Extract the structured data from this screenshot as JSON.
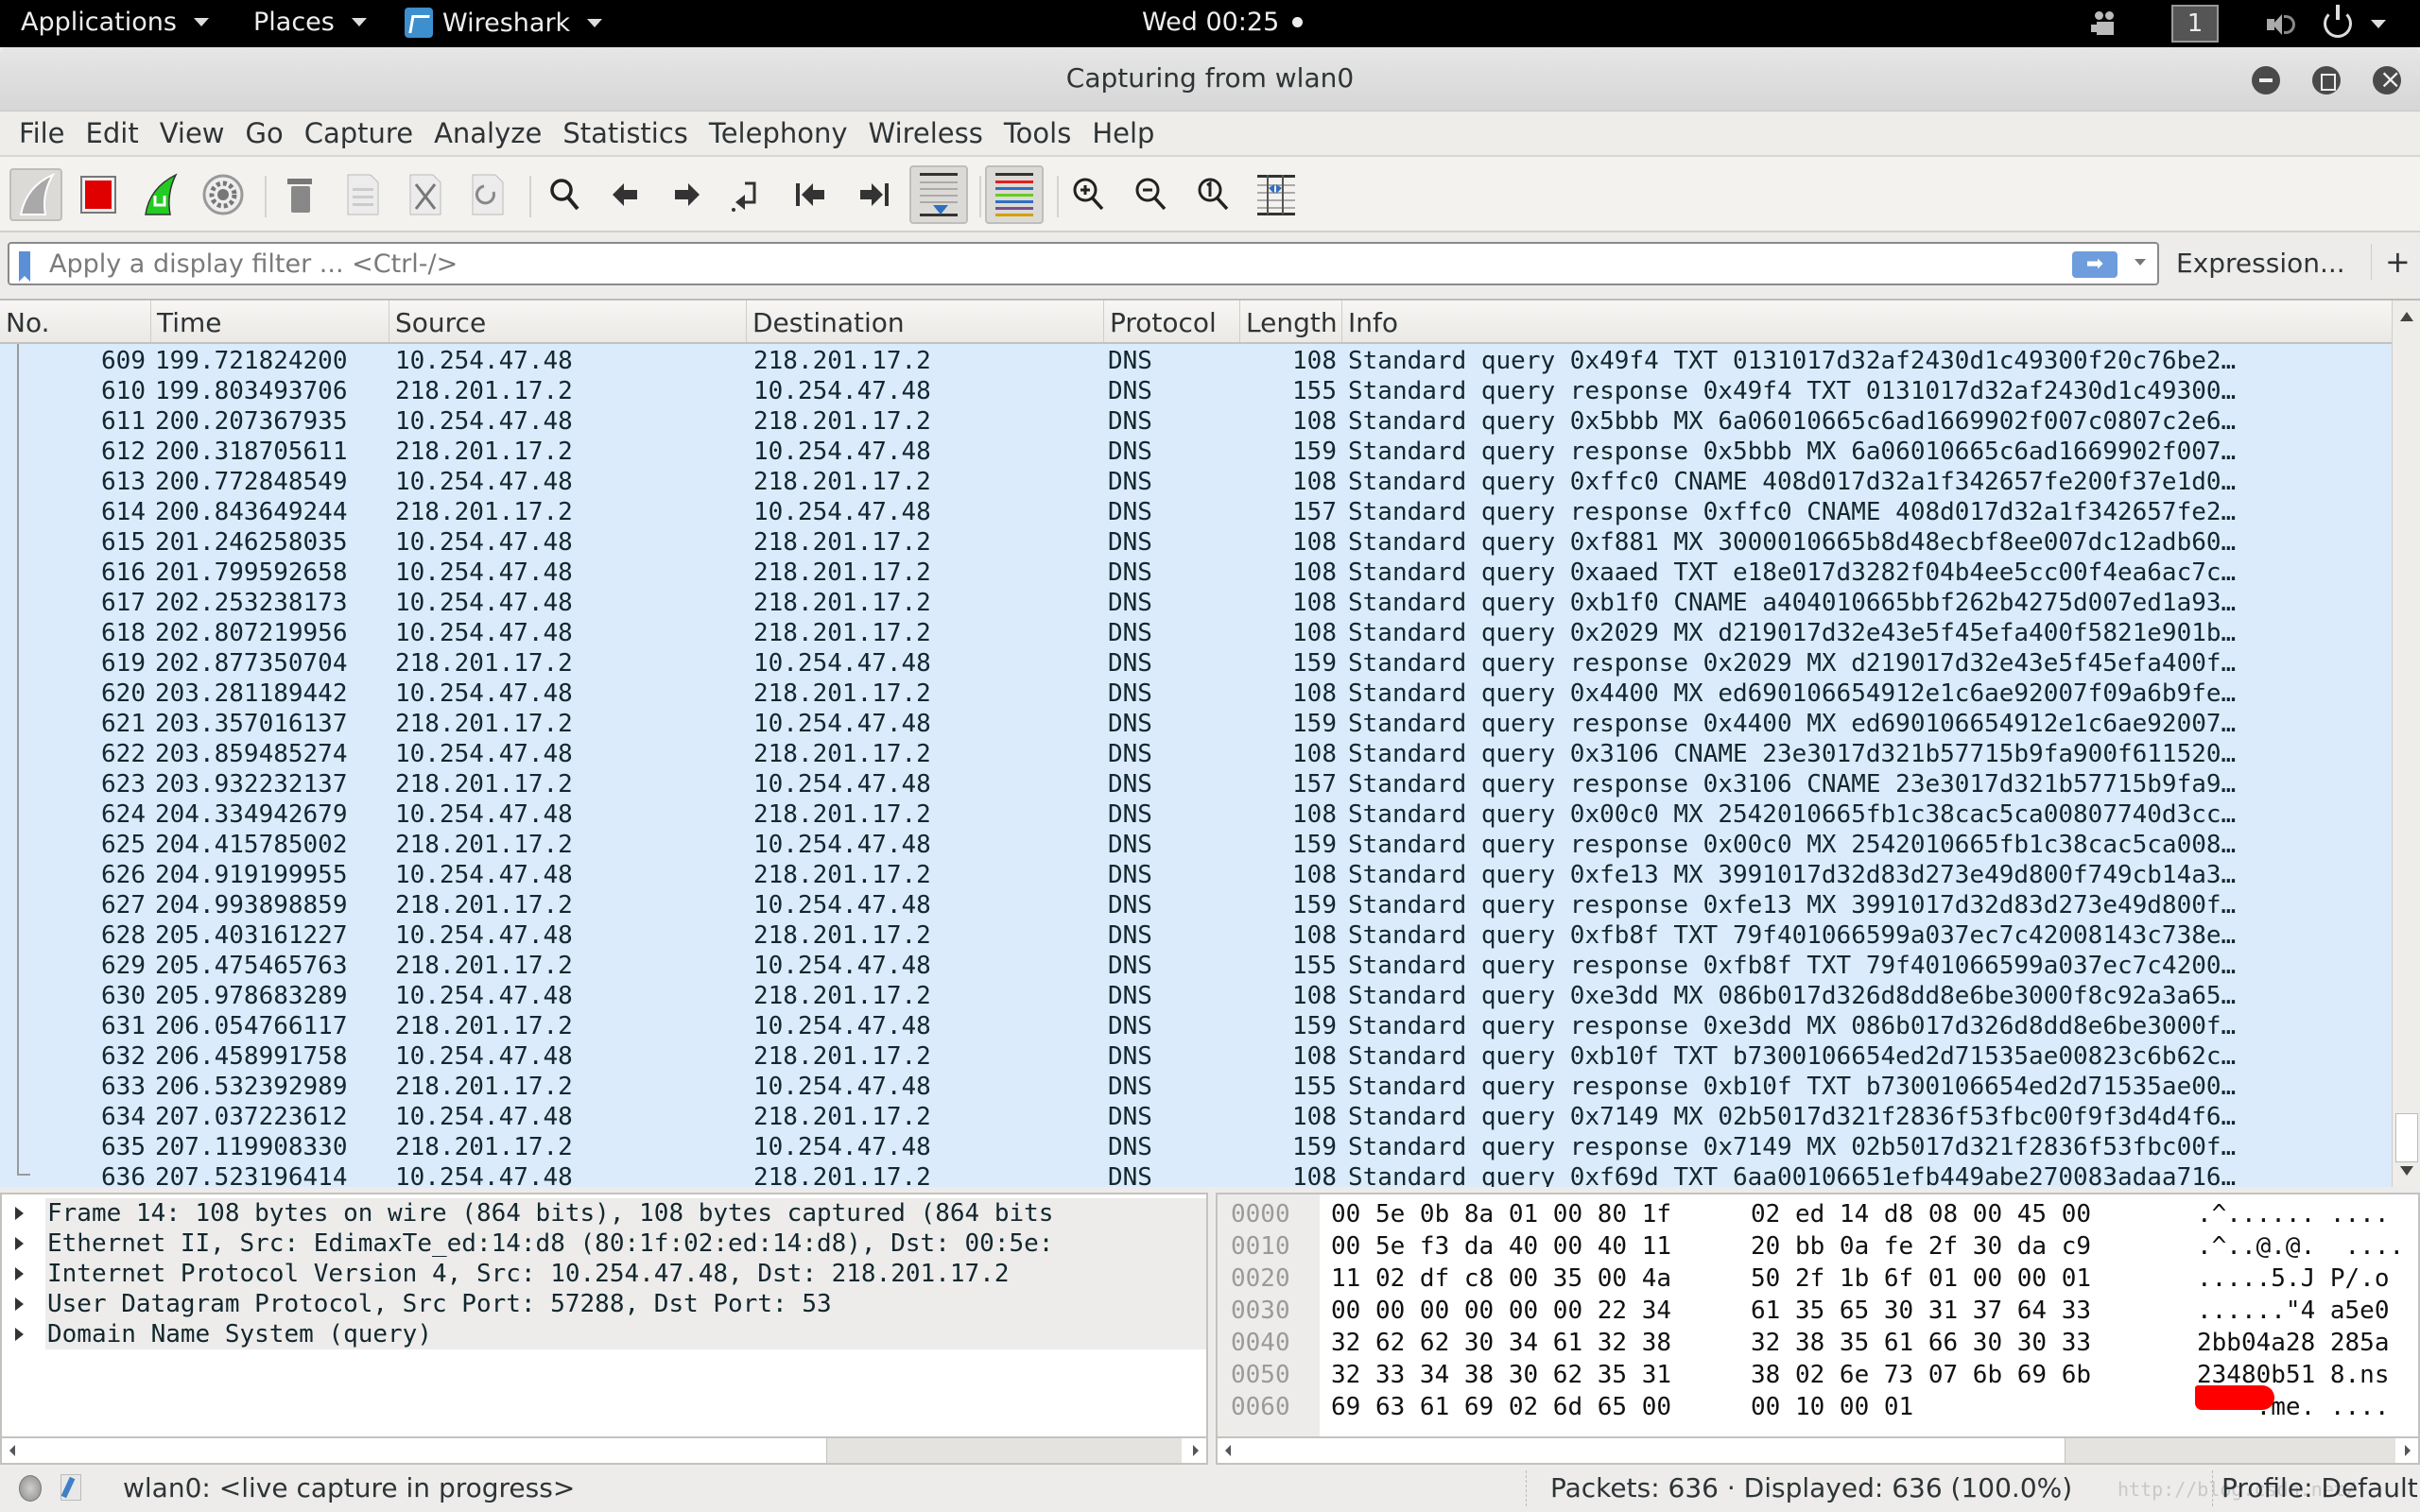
{
  "topbar": {
    "applications": "Applications",
    "places": "Places",
    "app_name": "Wireshark",
    "clock": "Wed 00:25",
    "workspace": "1"
  },
  "window": {
    "title": "Capturing from wlan0"
  },
  "menu": [
    "File",
    "Edit",
    "View",
    "Go",
    "Capture",
    "Analyze",
    "Statistics",
    "Telephony",
    "Wireless",
    "Tools",
    "Help"
  ],
  "toolbar": {
    "icons": [
      "start-capture-icon",
      "stop-capture-icon",
      "restart-capture-icon",
      "capture-options-icon",
      "open-file-icon",
      "save-file-icon",
      "close-file-icon",
      "reload-file-icon",
      "find-packet-icon",
      "go-back-icon",
      "go-forward-icon",
      "go-to-packet-icon",
      "first-packet-icon",
      "last-packet-icon",
      "autoscroll-icon",
      "colorize-icon",
      "zoom-in-icon",
      "zoom-out-icon",
      "normal-size-icon",
      "resize-columns-icon"
    ]
  },
  "filter": {
    "placeholder": "Apply a display filter ... <Ctrl-/>",
    "apply_symbol": "➡",
    "expression_label": "Expression...",
    "add_label": "+"
  },
  "packet_list": {
    "columns": [
      "No.",
      "Time",
      "Source",
      "Destination",
      "Protocol",
      "Length",
      "Info"
    ],
    "rows": [
      {
        "no": "609",
        "time": "199.721824200",
        "src": "10.254.47.48",
        "dst": "218.201.17.2",
        "proto": "DNS",
        "len": "108",
        "info": "Standard query 0x49f4 TXT 0131017d32af2430d1c49300f20c76be2…"
      },
      {
        "no": "610",
        "time": "199.803493706",
        "src": "218.201.17.2",
        "dst": "10.254.47.48",
        "proto": "DNS",
        "len": "155",
        "info": "Standard query response 0x49f4 TXT 0131017d32af2430d1c49300…"
      },
      {
        "no": "611",
        "time": "200.207367935",
        "src": "10.254.47.48",
        "dst": "218.201.17.2",
        "proto": "DNS",
        "len": "108",
        "info": "Standard query 0x5bbb MX 6a06010665c6ad1669902f007c0807c2e6…"
      },
      {
        "no": "612",
        "time": "200.318705611",
        "src": "218.201.17.2",
        "dst": "10.254.47.48",
        "proto": "DNS",
        "len": "159",
        "info": "Standard query response 0x5bbb MX 6a06010665c6ad1669902f007…"
      },
      {
        "no": "613",
        "time": "200.772848549",
        "src": "10.254.47.48",
        "dst": "218.201.17.2",
        "proto": "DNS",
        "len": "108",
        "info": "Standard query 0xffc0 CNAME 408d017d32a1f342657fe200f37e1d0…"
      },
      {
        "no": "614",
        "time": "200.843649244",
        "src": "218.201.17.2",
        "dst": "10.254.47.48",
        "proto": "DNS",
        "len": "157",
        "info": "Standard query response 0xffc0 CNAME 408d017d32a1f342657fe2…"
      },
      {
        "no": "615",
        "time": "201.246258035",
        "src": "10.254.47.48",
        "dst": "218.201.17.2",
        "proto": "DNS",
        "len": "108",
        "info": "Standard query 0xf881 MX 3000010665b8d48ecbf8ee007dc12adb60…"
      },
      {
        "no": "616",
        "time": "201.799592658",
        "src": "10.254.47.48",
        "dst": "218.201.17.2",
        "proto": "DNS",
        "len": "108",
        "info": "Standard query 0xaaed TXT e18e017d3282f04b4ee5cc00f4ea6ac7c…"
      },
      {
        "no": "617",
        "time": "202.253238173",
        "src": "10.254.47.48",
        "dst": "218.201.17.2",
        "proto": "DNS",
        "len": "108",
        "info": "Standard query 0xb1f0 CNAME a404010665bbf262b4275d007ed1a93…"
      },
      {
        "no": "618",
        "time": "202.807219956",
        "src": "10.254.47.48",
        "dst": "218.201.17.2",
        "proto": "DNS",
        "len": "108",
        "info": "Standard query 0x2029 MX d219017d32e43e5f45efa400f5821e901b…"
      },
      {
        "no": "619",
        "time": "202.877350704",
        "src": "218.201.17.2",
        "dst": "10.254.47.48",
        "proto": "DNS",
        "len": "159",
        "info": "Standard query response 0x2029 MX d219017d32e43e5f45efa400f…"
      },
      {
        "no": "620",
        "time": "203.281189442",
        "src": "10.254.47.48",
        "dst": "218.201.17.2",
        "proto": "DNS",
        "len": "108",
        "info": "Standard query 0x4400 MX ed690106654912e1c6ae92007f09a6b9fe…"
      },
      {
        "no": "621",
        "time": "203.357016137",
        "src": "218.201.17.2",
        "dst": "10.254.47.48",
        "proto": "DNS",
        "len": "159",
        "info": "Standard query response 0x4400 MX ed690106654912e1c6ae92007…"
      },
      {
        "no": "622",
        "time": "203.859485274",
        "src": "10.254.47.48",
        "dst": "218.201.17.2",
        "proto": "DNS",
        "len": "108",
        "info": "Standard query 0x3106 CNAME 23e3017d321b57715b9fa900f611520…"
      },
      {
        "no": "623",
        "time": "203.932232137",
        "src": "218.201.17.2",
        "dst": "10.254.47.48",
        "proto": "DNS",
        "len": "157",
        "info": "Standard query response 0x3106 CNAME 23e3017d321b57715b9fa9…"
      },
      {
        "no": "624",
        "time": "204.334942679",
        "src": "10.254.47.48",
        "dst": "218.201.17.2",
        "proto": "DNS",
        "len": "108",
        "info": "Standard query 0x00c0 MX 2542010665fb1c38cac5ca00807740d3cc…"
      },
      {
        "no": "625",
        "time": "204.415785002",
        "src": "218.201.17.2",
        "dst": "10.254.47.48",
        "proto": "DNS",
        "len": "159",
        "info": "Standard query response 0x00c0 MX 2542010665fb1c38cac5ca008…"
      },
      {
        "no": "626",
        "time": "204.919199955",
        "src": "10.254.47.48",
        "dst": "218.201.17.2",
        "proto": "DNS",
        "len": "108",
        "info": "Standard query 0xfe13 MX 3991017d32d83d273e49d800f749cb14a3…"
      },
      {
        "no": "627",
        "time": "204.993898859",
        "src": "218.201.17.2",
        "dst": "10.254.47.48",
        "proto": "DNS",
        "len": "159",
        "info": "Standard query response 0xfe13 MX 3991017d32d83d273e49d800f…"
      },
      {
        "no": "628",
        "time": "205.403161227",
        "src": "10.254.47.48",
        "dst": "218.201.17.2",
        "proto": "DNS",
        "len": "108",
        "info": "Standard query 0xfb8f TXT 79f401066599a037ec7c42008143c738e…"
      },
      {
        "no": "629",
        "time": "205.475465763",
        "src": "218.201.17.2",
        "dst": "10.254.47.48",
        "proto": "DNS",
        "len": "155",
        "info": "Standard query response 0xfb8f TXT 79f401066599a037ec7c4200…"
      },
      {
        "no": "630",
        "time": "205.978683289",
        "src": "10.254.47.48",
        "dst": "218.201.17.2",
        "proto": "DNS",
        "len": "108",
        "info": "Standard query 0xe3dd MX 086b017d326d8dd8e6be3000f8c92a3a65…"
      },
      {
        "no": "631",
        "time": "206.054766117",
        "src": "218.201.17.2",
        "dst": "10.254.47.48",
        "proto": "DNS",
        "len": "159",
        "info": "Standard query response 0xe3dd MX 086b017d326d8dd8e6be3000f…"
      },
      {
        "no": "632",
        "time": "206.458991758",
        "src": "10.254.47.48",
        "dst": "218.201.17.2",
        "proto": "DNS",
        "len": "108",
        "info": "Standard query 0xb10f TXT b7300106654ed2d71535ae00823c6b62c…"
      },
      {
        "no": "633",
        "time": "206.532392989",
        "src": "218.201.17.2",
        "dst": "10.254.47.48",
        "proto": "DNS",
        "len": "155",
        "info": "Standard query response 0xb10f TXT b7300106654ed2d71535ae00…"
      },
      {
        "no": "634",
        "time": "207.037223612",
        "src": "10.254.47.48",
        "dst": "218.201.17.2",
        "proto": "DNS",
        "len": "108",
        "info": "Standard query 0x7149 MX 02b5017d321f2836f53fbc00f9f3d4d4f6…"
      },
      {
        "no": "635",
        "time": "207.119908330",
        "src": "218.201.17.2",
        "dst": "10.254.47.48",
        "proto": "DNS",
        "len": "159",
        "info": "Standard query response 0x7149 MX 02b5017d321f2836f53fbc00f…"
      },
      {
        "no": "636",
        "time": "207.523196414",
        "src": "10.254.47.48",
        "dst": "218.201.17.2",
        "proto": "DNS",
        "len": "108",
        "info": "Standard query 0xf69d TXT 6aa00106651efb449abe270083adaa716…"
      }
    ],
    "row_color": "#dbebfc"
  },
  "details": [
    "Frame 14: 108 bytes on wire (864 bits), 108 bytes captured (864 bits",
    "Ethernet II, Src: EdimaxTe_ed:14:d8 (80:1f:02:ed:14:d8), Dst: 00:5e:",
    "Internet Protocol Version 4, Src: 10.254.47.48, Dst: 218.201.17.2",
    "User Datagram Protocol, Src Port: 57288, Dst Port: 53",
    "Domain Name System (query)"
  ],
  "hex": [
    {
      "offset": "0000",
      "b1": "00 5e 0b 8a 01 00 80 1f",
      "b2": "02 ed 14 d8 08 00 45 00",
      "ascii": ".^...... ...."
    },
    {
      "offset": "0010",
      "b1": "00 5e f3 da 40 00 40 11",
      "b2": "20 bb 0a fe 2f 30 da c9",
      "ascii": ".^..@.@.  ...."
    },
    {
      "offset": "0020",
      "b1": "11 02 df c8 00 35 00 4a",
      "b2": "50 2f 1b 6f 01 00 00 01",
      "ascii": ".....5.J P/.o"
    },
    {
      "offset": "0030",
      "b1": "00 00 00 00 00 00 22 34",
      "b2": "61 35 65 30 31 37 64 33",
      "ascii": "......\"4 a5e0"
    },
    {
      "offset": "0040",
      "b1": "32 62 62 30 34 61 32 38",
      "b2": "32 38 35 61 66 30 30 33",
      "ascii": "2bb04a28 285a"
    },
    {
      "offset": "0050",
      "b1": "32 33 34 38 30 62 35 31",
      "b2": "38 02 6e 73 07 6b 69 6b",
      "ascii": "23480b51 8.ns"
    },
    {
      "offset": "0060",
      "b1": "69 63 61 69 02 6d 65 00",
      "b2": "00 10 00 01",
      "ascii": "    .me. ...."
    }
  ],
  "status": {
    "capture_text": "wlan0: <live capture in progress>",
    "packets_text": "Packets: 636 · Displayed: 636 (100.0%)",
    "profile_text": "Profile: Default",
    "watermark": "http://blog.csdn.net/"
  }
}
